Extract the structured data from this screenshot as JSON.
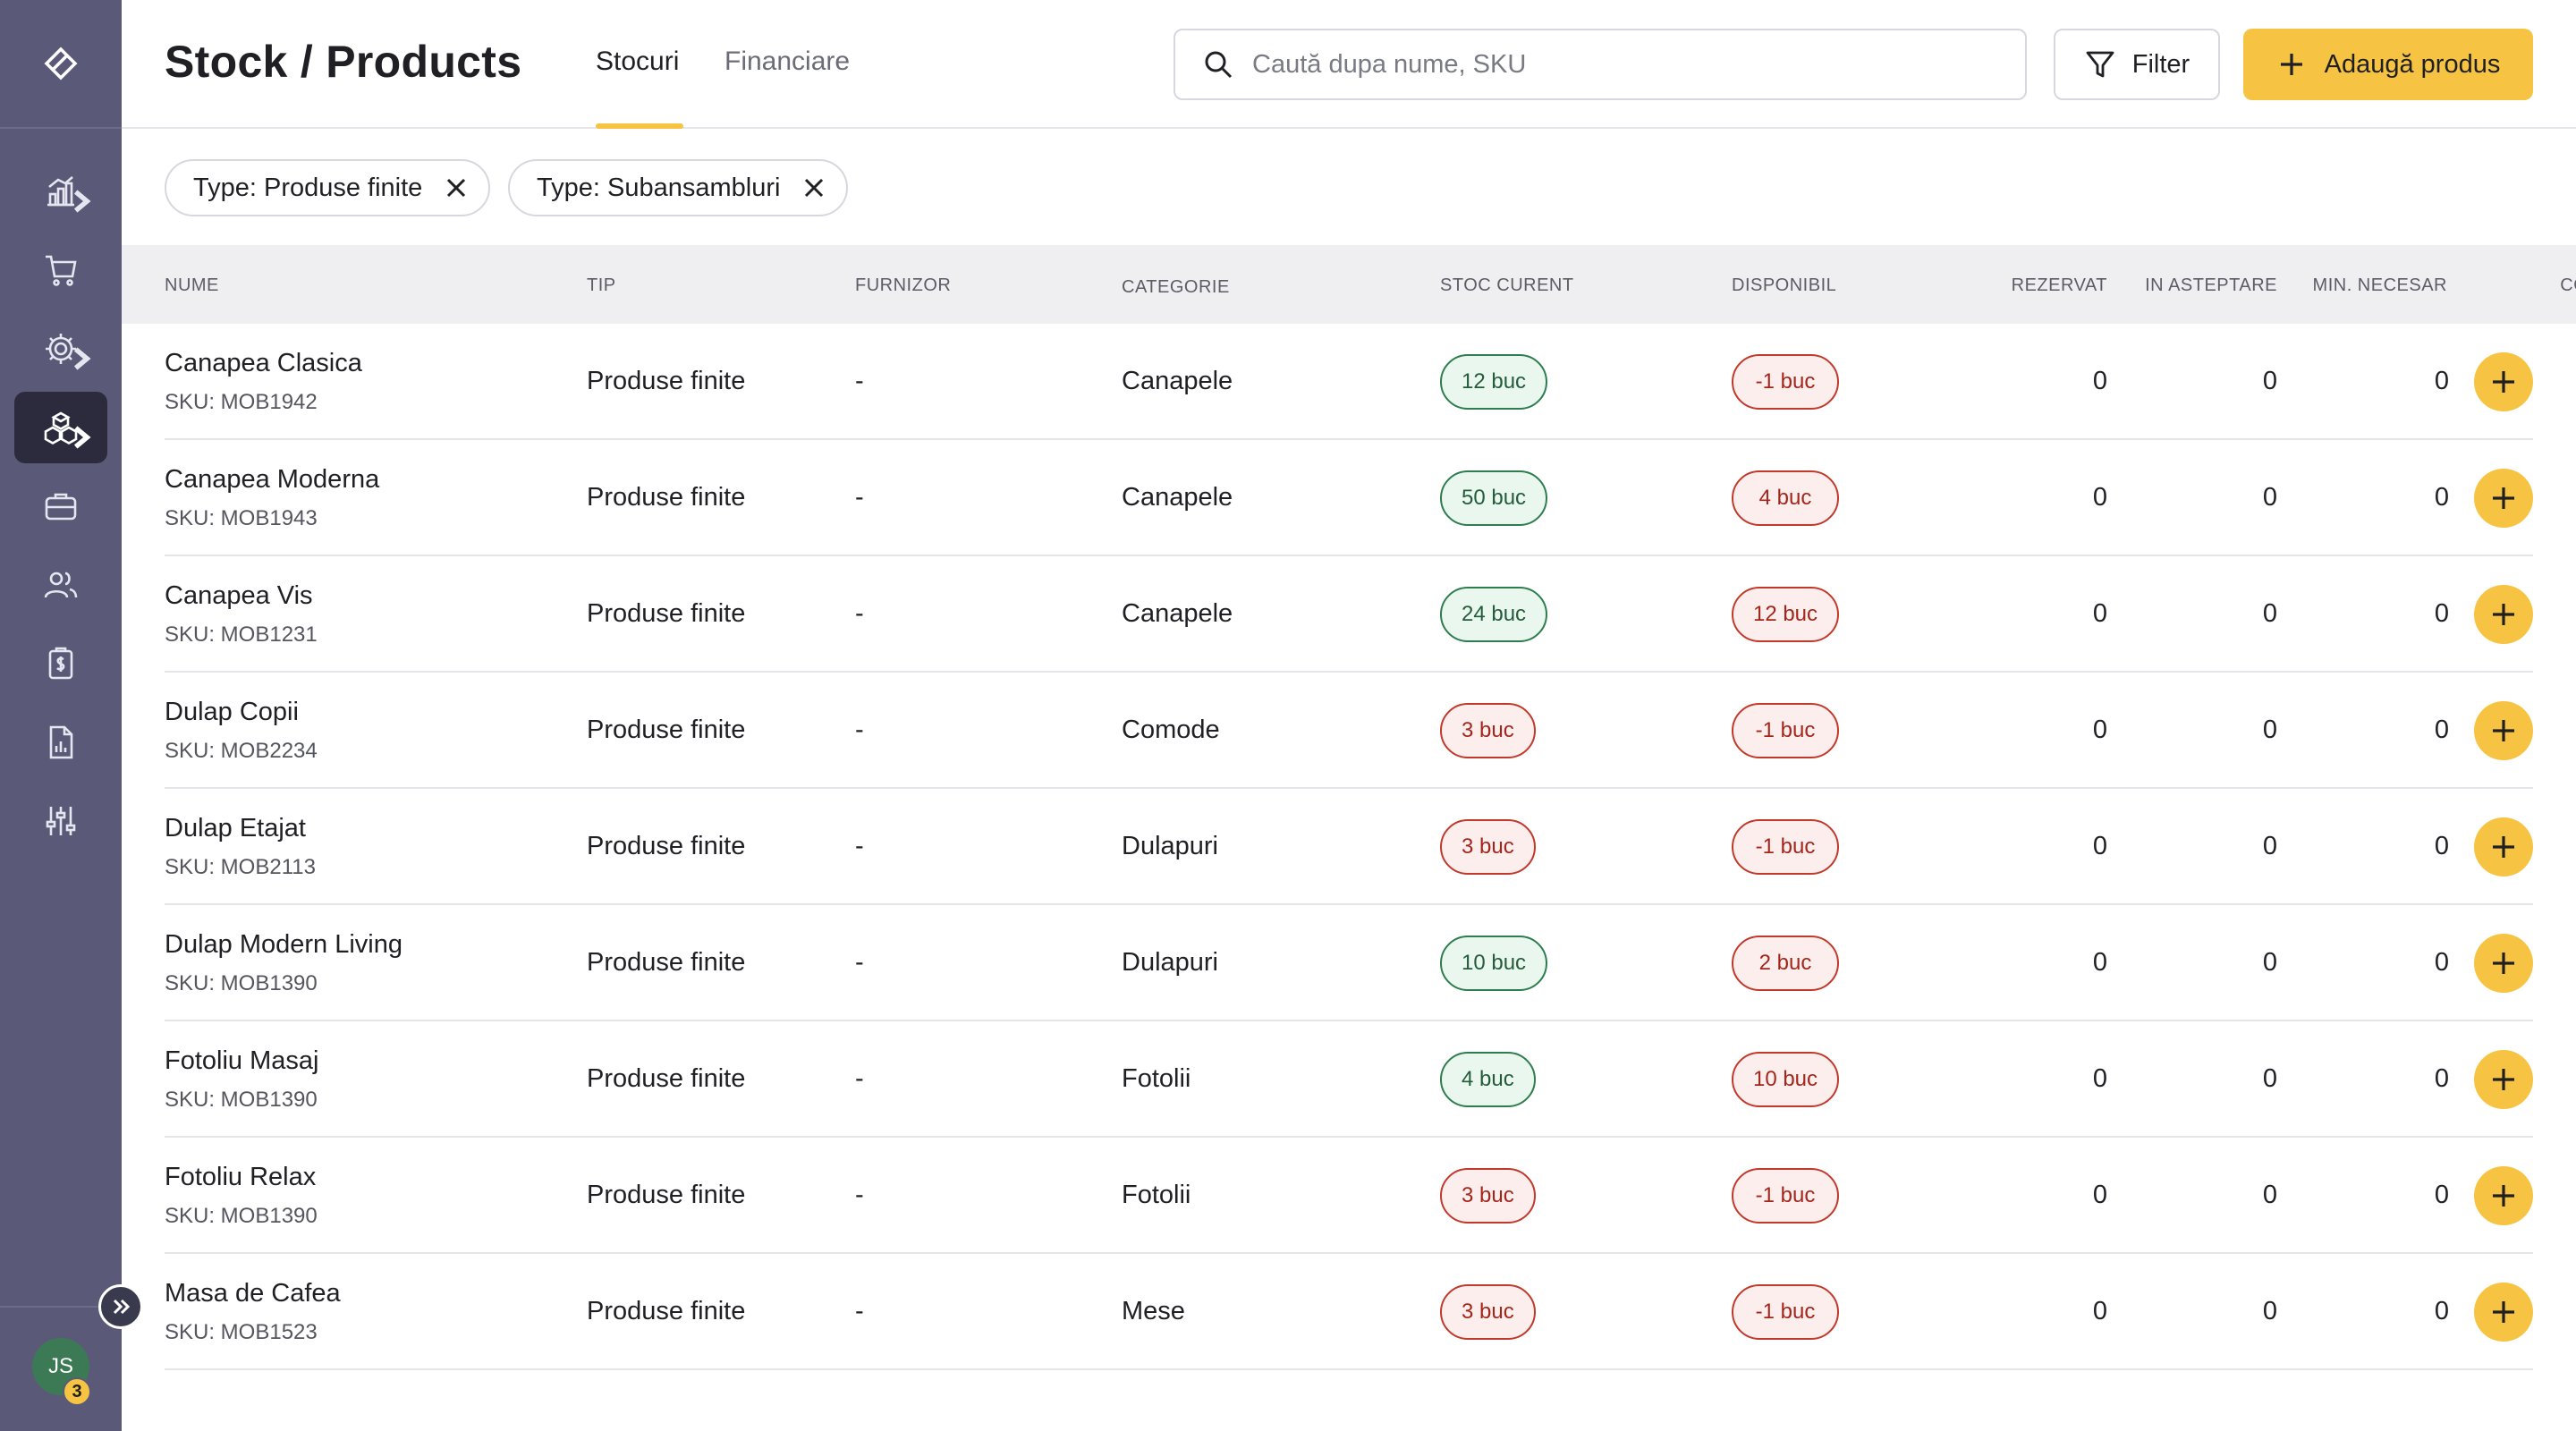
{
  "sidebar": {
    "items": [
      {
        "icon": "chart-icon",
        "active": false,
        "has_chevron": true
      },
      {
        "icon": "cart-icon",
        "active": false,
        "has_chevron": false
      },
      {
        "icon": "settings-icon",
        "active": false,
        "has_chevron": true
      },
      {
        "icon": "products-icon",
        "active": true,
        "has_chevron": true
      },
      {
        "icon": "briefcase-icon",
        "active": false,
        "has_chevron": false
      },
      {
        "icon": "users-icon",
        "active": false,
        "has_chevron": false
      },
      {
        "icon": "invoice-icon",
        "active": false,
        "has_chevron": false
      },
      {
        "icon": "report-icon",
        "active": false,
        "has_chevron": false
      },
      {
        "icon": "sliders-icon",
        "active": false,
        "has_chevron": false
      }
    ],
    "user_initials": "JS",
    "notification_count": "3"
  },
  "header": {
    "title": "Stock / Products",
    "tabs": [
      {
        "label": "Stocuri",
        "active": true
      },
      {
        "label": "Financiare",
        "active": false
      }
    ],
    "search_placeholder": "Caută dupa nume, SKU",
    "filter_label": "Filter",
    "add_label": "Adaugă produs"
  },
  "filters": [
    {
      "label": "Type: Produse finite"
    },
    {
      "label": "Type: Subansambluri"
    }
  ],
  "table": {
    "columns": {
      "name": "NUME",
      "type": "TIP",
      "supplier": "FURNIZOR",
      "category": "CATEGORIE",
      "stock": "STOC CURENT",
      "available": "DISPONIBIL",
      "reserved": "REZERVAT",
      "pending": "IN ASTEPTARE",
      "min_required": "MIN. NECESAR",
      "order": "COMANDA"
    },
    "rows": [
      {
        "name": "Canapea Clasica",
        "sku": "SKU: MOB1942",
        "type": "Produse finite",
        "supplier": "-",
        "category": "Canapele",
        "stock": "12 buc",
        "stock_status": "green",
        "available": "-1 buc",
        "available_status": "red",
        "reserved": "0",
        "pending": "0",
        "min_required": "0"
      },
      {
        "name": "Canapea Moderna",
        "sku": "SKU: MOB1943",
        "type": "Produse finite",
        "supplier": "-",
        "category": "Canapele",
        "stock": "50 buc",
        "stock_status": "green",
        "available": "4 buc",
        "available_status": "red",
        "reserved": "0",
        "pending": "0",
        "min_required": "0"
      },
      {
        "name": "Canapea Vis",
        "sku": "SKU: MOB1231",
        "type": "Produse finite",
        "supplier": "-",
        "category": "Canapele",
        "stock": "24 buc",
        "stock_status": "green",
        "available": "12 buc",
        "available_status": "red",
        "reserved": "0",
        "pending": "0",
        "min_required": "0"
      },
      {
        "name": "Dulap Copii",
        "sku": "SKU: MOB2234",
        "type": "Produse finite",
        "supplier": "-",
        "category": "Comode",
        "stock": "3 buc",
        "stock_status": "red",
        "available": "-1 buc",
        "available_status": "red",
        "reserved": "0",
        "pending": "0",
        "min_required": "0"
      },
      {
        "name": "Dulap Etajat",
        "sku": "SKU: MOB2113",
        "type": "Produse finite",
        "supplier": "-",
        "category": "Dulapuri",
        "stock": "3 buc",
        "stock_status": "red",
        "available": "-1 buc",
        "available_status": "red",
        "reserved": "0",
        "pending": "0",
        "min_required": "0"
      },
      {
        "name": "Dulap Modern Living",
        "sku": "SKU: MOB1390",
        "type": "Produse finite",
        "supplier": "-",
        "category": "Dulapuri",
        "stock": "10 buc",
        "stock_status": "green",
        "available": "2 buc",
        "available_status": "red",
        "reserved": "0",
        "pending": "0",
        "min_required": "0"
      },
      {
        "name": "Fotoliu Masaj",
        "sku": "SKU: MOB1390",
        "type": "Produse finite",
        "supplier": "-",
        "category": "Fotolii",
        "stock": "4 buc",
        "stock_status": "green",
        "available": "10 buc",
        "available_status": "red",
        "reserved": "0",
        "pending": "0",
        "min_required": "0"
      },
      {
        "name": "Fotoliu Relax",
        "sku": "SKU: MOB1390",
        "type": "Produse finite",
        "supplier": "-",
        "category": "Fotolii",
        "stock": "3 buc",
        "stock_status": "red",
        "available": "-1 buc",
        "available_status": "red",
        "reserved": "0",
        "pending": "0",
        "min_required": "0"
      },
      {
        "name": "Masa de Cafea",
        "sku": "SKU: MOB1523",
        "type": "Produse finite",
        "supplier": "-",
        "category": "Mese",
        "stock": "3 buc",
        "stock_status": "red",
        "available": "-1 buc",
        "available_status": "red",
        "reserved": "0",
        "pending": "0",
        "min_required": "0"
      }
    ]
  },
  "colors": {
    "sidebar": "#5a5a78",
    "sidebar_active": "#2b2b3d",
    "accent": "#f6c343",
    "ok_text": "#245c3b",
    "alert_text": "#a3261b"
  }
}
